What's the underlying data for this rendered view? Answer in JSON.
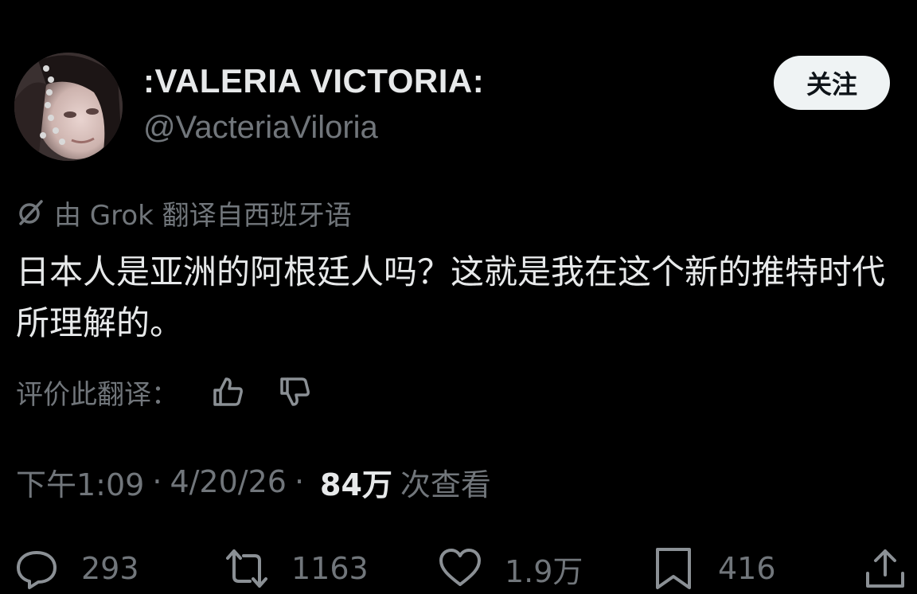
{
  "author": {
    "display_name": ":VALERIA VICTORIA:",
    "handle": "@VacteriaViloria"
  },
  "follow_button": {
    "label": "关注"
  },
  "translation": {
    "label": "由 Grok 翻译自西班牙语",
    "icon": "grok-icon"
  },
  "tweet": {
    "text": "日本人是亚洲的阿根廷人吗？这就是我在这个新的推特时代所理解的。"
  },
  "rate_translation": {
    "label": "评价此翻译：",
    "thumbs_up_icon": "thumbs-up-icon",
    "thumbs_down_icon": "thumbs-down-icon"
  },
  "meta": {
    "time": "下午1:09",
    "separator": "·",
    "date": "4/20/26",
    "views_count": "84万",
    "views_label": "次查看"
  },
  "actions": {
    "replies": "293",
    "reposts": "1163",
    "likes": "1.9万",
    "bookmarks": "416"
  },
  "colors": {
    "background": "#000000",
    "primary_text": "#e7e9ea",
    "secondary_text": "#71767b",
    "button_bg": "#eff3f4"
  }
}
